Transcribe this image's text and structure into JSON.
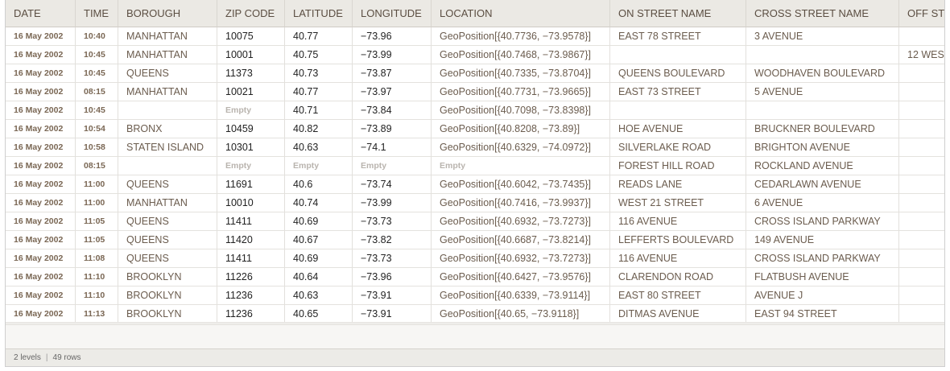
{
  "columns": [
    "DATE",
    "TIME",
    "BOROUGH",
    "ZIP CODE",
    "LATITUDE",
    "LONGITUDE",
    "LOCATION",
    "ON STREET NAME",
    "CROSS STREET NAME",
    "OFF ST"
  ],
  "empty_label": "Empty",
  "rows": [
    [
      "16 May 2002",
      "10:40",
      "MANHATTAN",
      "10075",
      "40.77",
      "−73.96",
      "GeoPosition[{40.7736, −73.9578}]",
      "EAST 78 STREET",
      "3 AVENUE",
      ""
    ],
    [
      "16 May 2002",
      "10:45",
      "MANHATTAN",
      "10001",
      "40.75",
      "−73.99",
      "GeoPosition[{40.7468, −73.9867}]",
      "",
      "",
      "12 WES"
    ],
    [
      "16 May 2002",
      "10:45",
      "QUEENS",
      "11373",
      "40.73",
      "−73.87",
      "GeoPosition[{40.7335, −73.8704}]",
      "QUEENS BOULEVARD",
      "WOODHAVEN BOULEVARD",
      ""
    ],
    [
      "16 May 2002",
      "08:15",
      "MANHATTAN",
      "10021",
      "40.77",
      "−73.97",
      "GeoPosition[{40.7731, −73.9665}]",
      "EAST 73 STREET",
      "5 AVENUE",
      ""
    ],
    [
      "16 May 2002",
      "10:45",
      "",
      null,
      "40.71",
      "−73.84",
      "GeoPosition[{40.7098, −73.8398}]",
      "",
      "",
      ""
    ],
    [
      "16 May 2002",
      "10:54",
      "BRONX",
      "10459",
      "40.82",
      "−73.89",
      "GeoPosition[{40.8208, −73.89}]",
      "HOE AVENUE",
      "BRUCKNER BOULEVARD",
      ""
    ],
    [
      "16 May 2002",
      "10:58",
      "STATEN ISLAND",
      "10301",
      "40.63",
      "−74.1",
      "GeoPosition[{40.6329, −74.0972}]",
      "SILVERLAKE ROAD",
      "BRIGHTON AVENUE",
      ""
    ],
    [
      "16 May 2002",
      "08:15",
      "",
      null,
      null,
      null,
      null,
      "FOREST HILL ROAD",
      "ROCKLAND AVENUE",
      ""
    ],
    [
      "16 May 2002",
      "11:00",
      "QUEENS",
      "11691",
      "40.6",
      "−73.74",
      "GeoPosition[{40.6042, −73.7435}]",
      "READS LANE",
      "CEDARLAWN AVENUE",
      ""
    ],
    [
      "16 May 2002",
      "11:00",
      "MANHATTAN",
      "10010",
      "40.74",
      "−73.99",
      "GeoPosition[{40.7416, −73.9937}]",
      "WEST 21 STREET",
      "6 AVENUE",
      ""
    ],
    [
      "16 May 2002",
      "11:05",
      "QUEENS",
      "11411",
      "40.69",
      "−73.73",
      "GeoPosition[{40.6932, −73.7273}]",
      "116 AVENUE",
      "CROSS ISLAND PARKWAY",
      ""
    ],
    [
      "16 May 2002",
      "11:05",
      "QUEENS",
      "11420",
      "40.67",
      "−73.82",
      "GeoPosition[{40.6687, −73.8214}]",
      "LEFFERTS BOULEVARD",
      "149 AVENUE",
      ""
    ],
    [
      "16 May 2002",
      "11:08",
      "QUEENS",
      "11411",
      "40.69",
      "−73.73",
      "GeoPosition[{40.6932, −73.7273}]",
      "116 AVENUE",
      "CROSS ISLAND PARKWAY",
      ""
    ],
    [
      "16 May 2002",
      "11:10",
      "BROOKLYN",
      "11226",
      "40.64",
      "−73.96",
      "GeoPosition[{40.6427, −73.9576}]",
      "CLARENDON ROAD",
      "FLATBUSH AVENUE",
      ""
    ],
    [
      "16 May 2002",
      "11:10",
      "BROOKLYN",
      "11236",
      "40.63",
      "−73.91",
      "GeoPosition[{40.6339, −73.9114}]",
      "EAST 80 STREET",
      "AVENUE J",
      ""
    ],
    [
      "16 May 2002",
      "11:13",
      "BROOKLYN",
      "11236",
      "40.65",
      "−73.91",
      "GeoPosition[{40.65, −73.9118}]",
      "DITMAS AVENUE",
      "EAST 94 STREET",
      ""
    ]
  ],
  "status": {
    "levels": "2 levels",
    "rows": "49 rows"
  }
}
